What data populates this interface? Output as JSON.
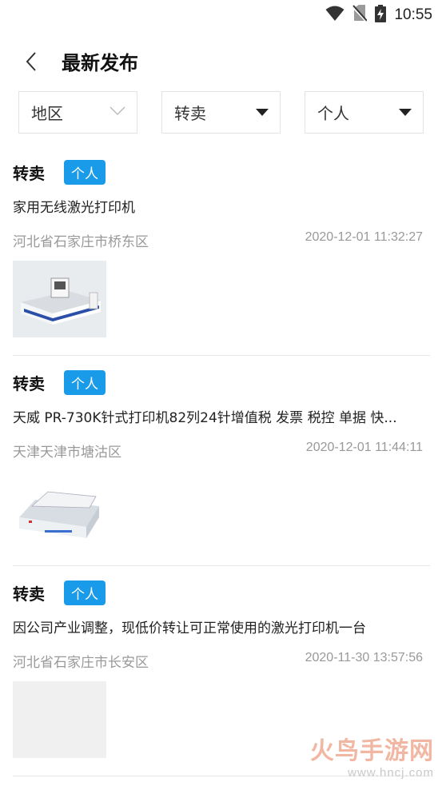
{
  "status_bar": {
    "time": "10:55"
  },
  "header": {
    "title": "最新发布"
  },
  "filters": [
    {
      "label": "地区"
    },
    {
      "label": "转卖"
    },
    {
      "label": "个人"
    }
  ],
  "posts": [
    {
      "type": "转卖",
      "badge": "个人",
      "title": "家用无线激光打印机",
      "location": "河北省石家庄市桥东区",
      "time": "2020-12-01 11:32:27"
    },
    {
      "type": "转卖",
      "badge": "个人",
      "title": "天威 PR-730K针式打印机82列24针增值税 发票 税控 单据 快...",
      "location": "天津天津市塘沽区",
      "time": "2020-12-01 11:44:11"
    },
    {
      "type": "转卖",
      "badge": "个人",
      "title": "因公司产业调整，现低价转让可正常使用的激光打印机一台",
      "location": "河北省石家庄市长安区",
      "time": "2020-11-30 13:57:56"
    }
  ],
  "watermark": {
    "text": "火鸟手游网",
    "url": "www.hncj.com"
  }
}
